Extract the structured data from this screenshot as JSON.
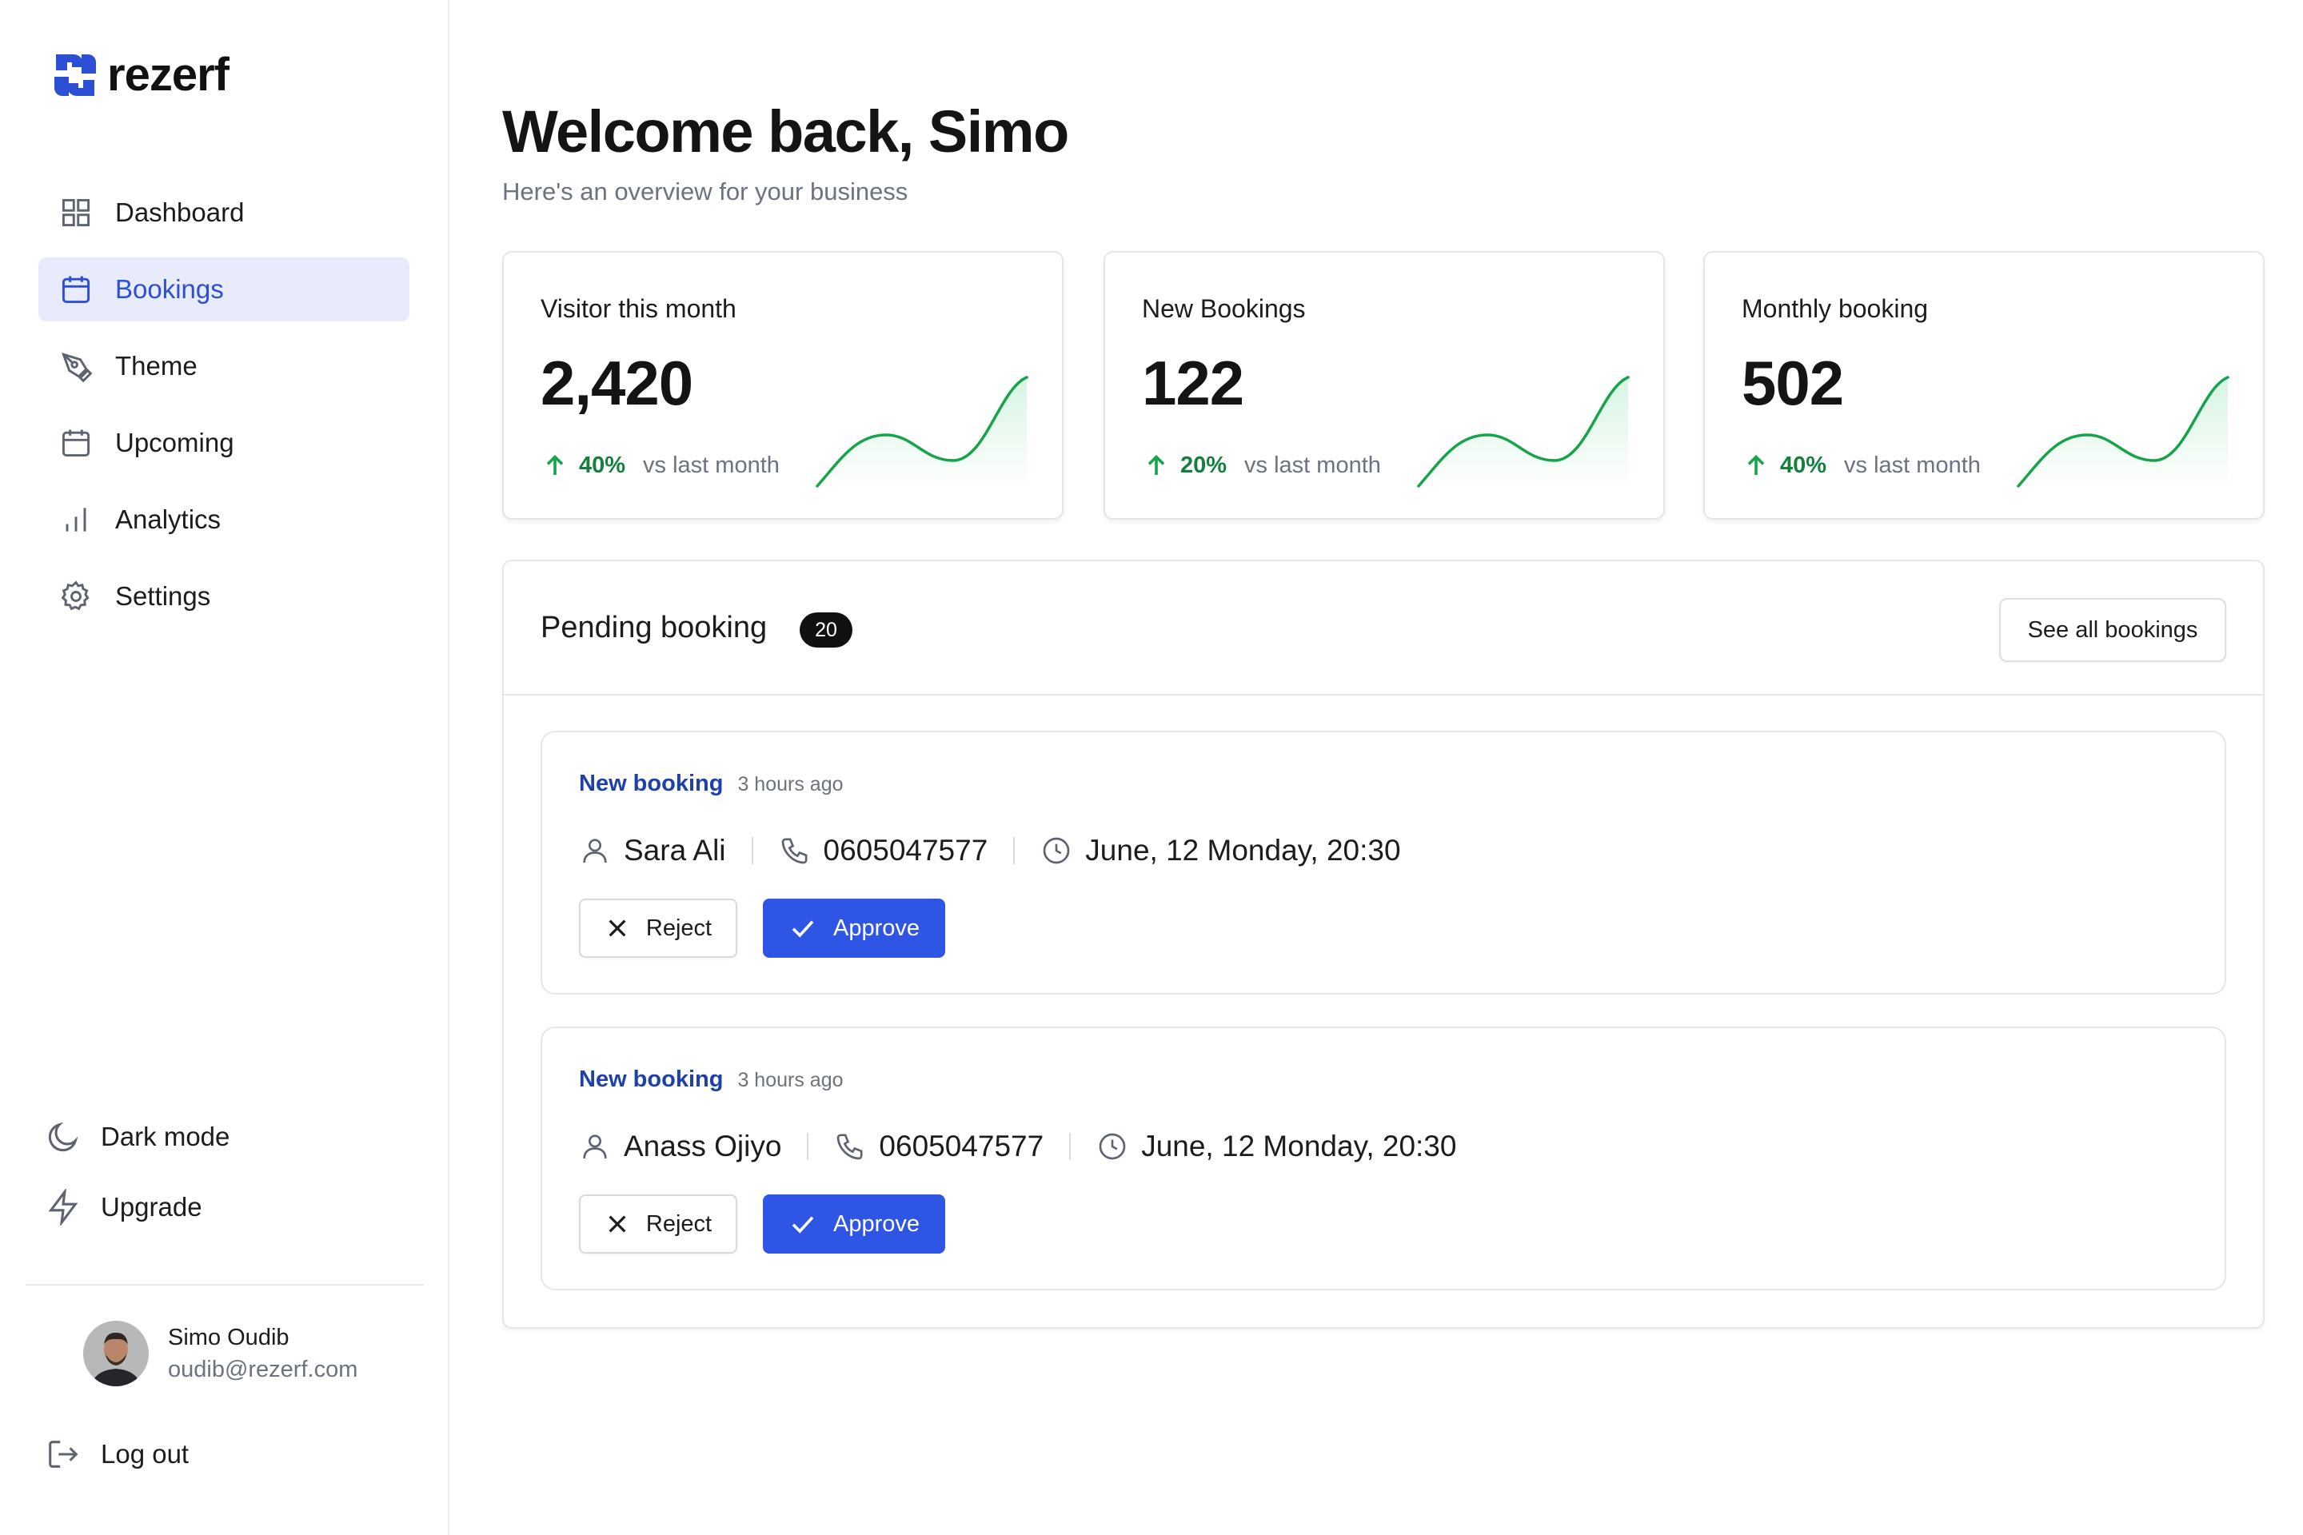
{
  "app": {
    "name": "rezerf"
  },
  "colors": {
    "accent": "#2f55e4",
    "active_bg": "#e8ebfb",
    "positive": "#16a34a",
    "logo": "#2d4fd6"
  },
  "sidebar": {
    "items": [
      {
        "label": "Dashboard",
        "icon": "dashboard-icon",
        "active": false
      },
      {
        "label": "Bookings",
        "icon": "calendar-icon",
        "active": true
      },
      {
        "label": "Theme",
        "icon": "pen-tool-icon",
        "active": false
      },
      {
        "label": "Upcoming",
        "icon": "calendar-icon",
        "active": false
      },
      {
        "label": "Analytics",
        "icon": "bar-chart-icon",
        "active": false
      },
      {
        "label": "Settings",
        "icon": "gear-icon",
        "active": false
      }
    ],
    "bottom": [
      {
        "label": "Dark mode",
        "icon": "moon-icon"
      },
      {
        "label": "Upgrade",
        "icon": "lightning-icon"
      }
    ],
    "profile": {
      "name": "Simo Oudib",
      "email": "oudib@rezerf.com"
    },
    "logout_label": "Log out"
  },
  "header": {
    "title": "Welcome back, Simo",
    "subtitle": "Here's an overview for your business"
  },
  "stats": [
    {
      "title": "Visitor this month",
      "value": "2,420",
      "change": "40%",
      "vs": "vs last month",
      "trend": "up"
    },
    {
      "title": "New Bookings",
      "value": "122",
      "change": "20%",
      "vs": "vs last month",
      "trend": "up"
    },
    {
      "title": "Monthly booking",
      "value": "502",
      "change": "40%",
      "vs": "vs last month",
      "trend": "up"
    }
  ],
  "pending": {
    "title": "Pending booking",
    "count": "20",
    "see_all_label": "See all bookings",
    "bookings": [
      {
        "type": "New booking",
        "time": "3 hours ago",
        "name": "Sara Ali",
        "phone": "0605047577",
        "datetime": "June, 12 Monday, 20:30",
        "reject_label": "Reject",
        "approve_label": "Approve"
      },
      {
        "type": "New booking",
        "time": "3 hours ago",
        "name": "Anass Ojiyo",
        "phone": "0605047577",
        "datetime": "June, 12 Monday, 20:30",
        "reject_label": "Reject",
        "approve_label": "Approve"
      }
    ]
  }
}
